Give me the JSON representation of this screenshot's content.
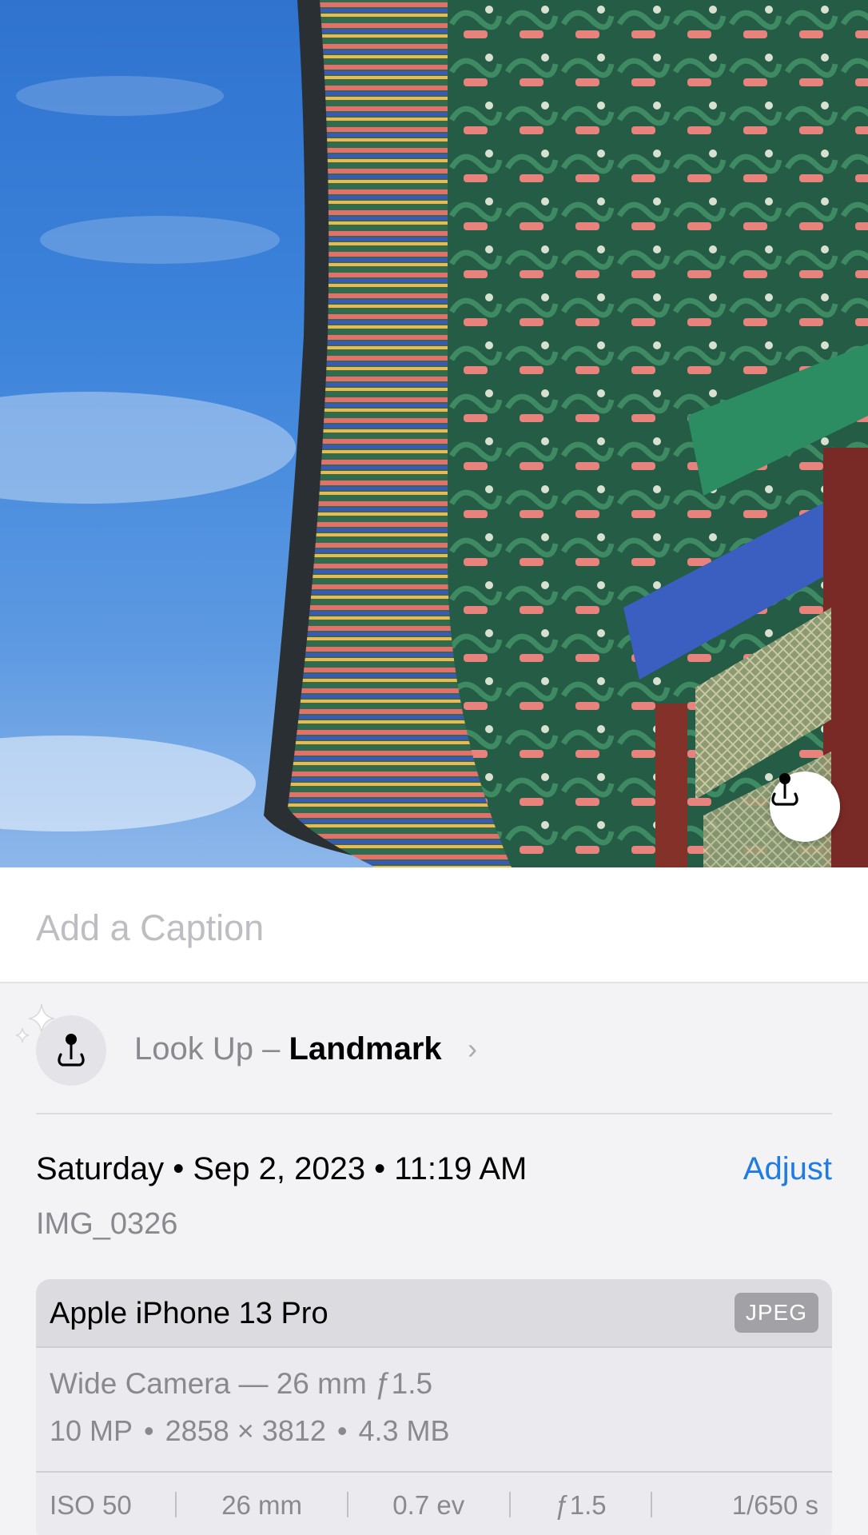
{
  "caption": {
    "placeholder": "Add a Caption"
  },
  "lookup": {
    "prefix": "Look Up – ",
    "subject": "Landmark",
    "chevron": "›"
  },
  "info": {
    "date_time": "Saturday • Sep 2, 2023 • 11:19 AM",
    "adjust_label": "Adjust",
    "filename": "IMG_0326"
  },
  "camera": {
    "device": "Apple iPhone 13 Pro",
    "format": "JPEG",
    "lens": "Wide Camera — 26 mm ƒ1.5",
    "megapixels": "10 MP",
    "resolution": "2858 × 3812",
    "file_size": "4.3 MB",
    "separator": "•",
    "exif": {
      "iso": "ISO 50",
      "focal_length": "26 mm",
      "exposure_bias": "0.7 ev",
      "aperture": "ƒ1.5",
      "shutter": "1/650 s"
    }
  },
  "colors": {
    "accent": "#1f7ce0",
    "secondary_text": "#8a8a8e",
    "badge": "#a1a1a6"
  },
  "icons": {
    "photo_overlay": "landmark-pin-icon",
    "lookup": "landmark-pin-icon",
    "sparkle": "sparkle-icon"
  }
}
